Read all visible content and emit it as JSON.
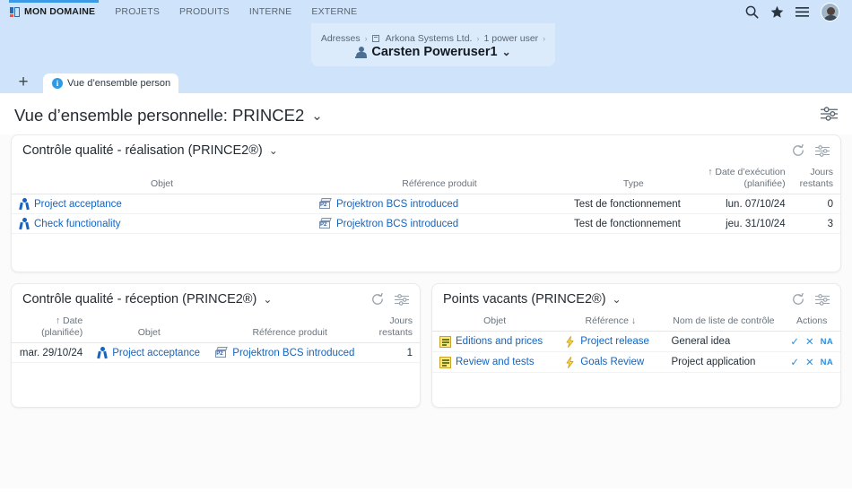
{
  "topnav": {
    "brand": "MON DOMAINE",
    "items": [
      "PROJETS",
      "PRODUITS",
      "INTERNE",
      "EXTERNE"
    ],
    "icons": [
      "search-icon",
      "star-icon",
      "menu-icon",
      "avatar"
    ]
  },
  "breadcrumb": {
    "items": [
      "Adresses",
      "Arkona Systems Ltd.",
      "1 power user"
    ],
    "title": "Carsten Poweruser1",
    "caret": "⌄"
  },
  "tabs": {
    "add_label": "+",
    "items": [
      {
        "label": "Vue d’ensemble person",
        "icon": "info-icon"
      }
    ]
  },
  "page": {
    "title": "Vue d’ensemble personnelle: PRINCE2",
    "caret": "⌄",
    "settings_icon": "sliders-icon"
  },
  "panels": [
    {
      "id": "quality-control-execution",
      "title": "Contrôle qualité - réalisation (PRINCE2®)",
      "caret": "⌄",
      "actions": [
        "refresh-icon",
        "sliders-icon"
      ],
      "columns": [
        {
          "label": "Objet",
          "align": "left"
        },
        {
          "label": "Référence produit",
          "align": "left"
        },
        {
          "label": "Type",
          "align": "left"
        },
        {
          "label": "↑ Date d’exécution (planifiée)",
          "align": "right"
        },
        {
          "label": "Jours restants",
          "align": "right"
        }
      ],
      "rows": [
        {
          "objet": "Project acceptance",
          "reference": "Projektron BCS introduced",
          "type": "Test de fonctionnement",
          "date": "lun. 07/10/24",
          "jours": "0"
        },
        {
          "objet": "Check functionality",
          "reference": "Projektron BCS introduced",
          "type": "Test de fonctionnement",
          "date": "jeu. 31/10/24",
          "jours": "3"
        }
      ]
    },
    {
      "id": "quality-control-reception",
      "title": "Contrôle qualité - réception (PRINCE2®)",
      "caret": "⌄",
      "actions": [
        "refresh-icon",
        "sliders-icon"
      ],
      "columns": [
        {
          "label": "↑ Date (planifiée)",
          "align": "right"
        },
        {
          "label": "Objet",
          "align": "left"
        },
        {
          "label": "Référence produit",
          "align": "left"
        },
        {
          "label": "Jours restants",
          "align": "right"
        }
      ],
      "rows": [
        {
          "date": "mar. 29/10/24",
          "objet": "Project acceptance",
          "reference": "Projektron BCS introduced",
          "jours": "1"
        }
      ]
    },
    {
      "id": "open-points",
      "title": "Points vacants (PRINCE2®)",
      "caret": "⌄",
      "actions": [
        "refresh-icon",
        "sliders-icon"
      ],
      "columns": [
        {
          "label": "Objet",
          "align": "left"
        },
        {
          "label": "Référence ↓",
          "align": "left"
        },
        {
          "label": "Nom de liste de contrôle",
          "align": "left"
        },
        {
          "label": "Actions",
          "align": "left"
        }
      ],
      "rows": [
        {
          "objet": "Editions and prices",
          "reference": "Project release",
          "checklist": "General idea",
          "actions": {
            "accept": "✓",
            "reject": "✕",
            "na": "NA"
          }
        },
        {
          "objet": "Review and tests",
          "reference": "Goals Review",
          "checklist": "Project application",
          "actions": {
            "accept": "✓",
            "reject": "✕",
            "na": "NA"
          }
        }
      ]
    }
  ],
  "colors": {
    "nav_bg": "#cfe4fa",
    "accent": "#3a9ae8",
    "link": "#1464c0",
    "panel_bg": "#ffffff",
    "content_bg": "#fbfbfc",
    "action_blue": "#2a90e0"
  }
}
